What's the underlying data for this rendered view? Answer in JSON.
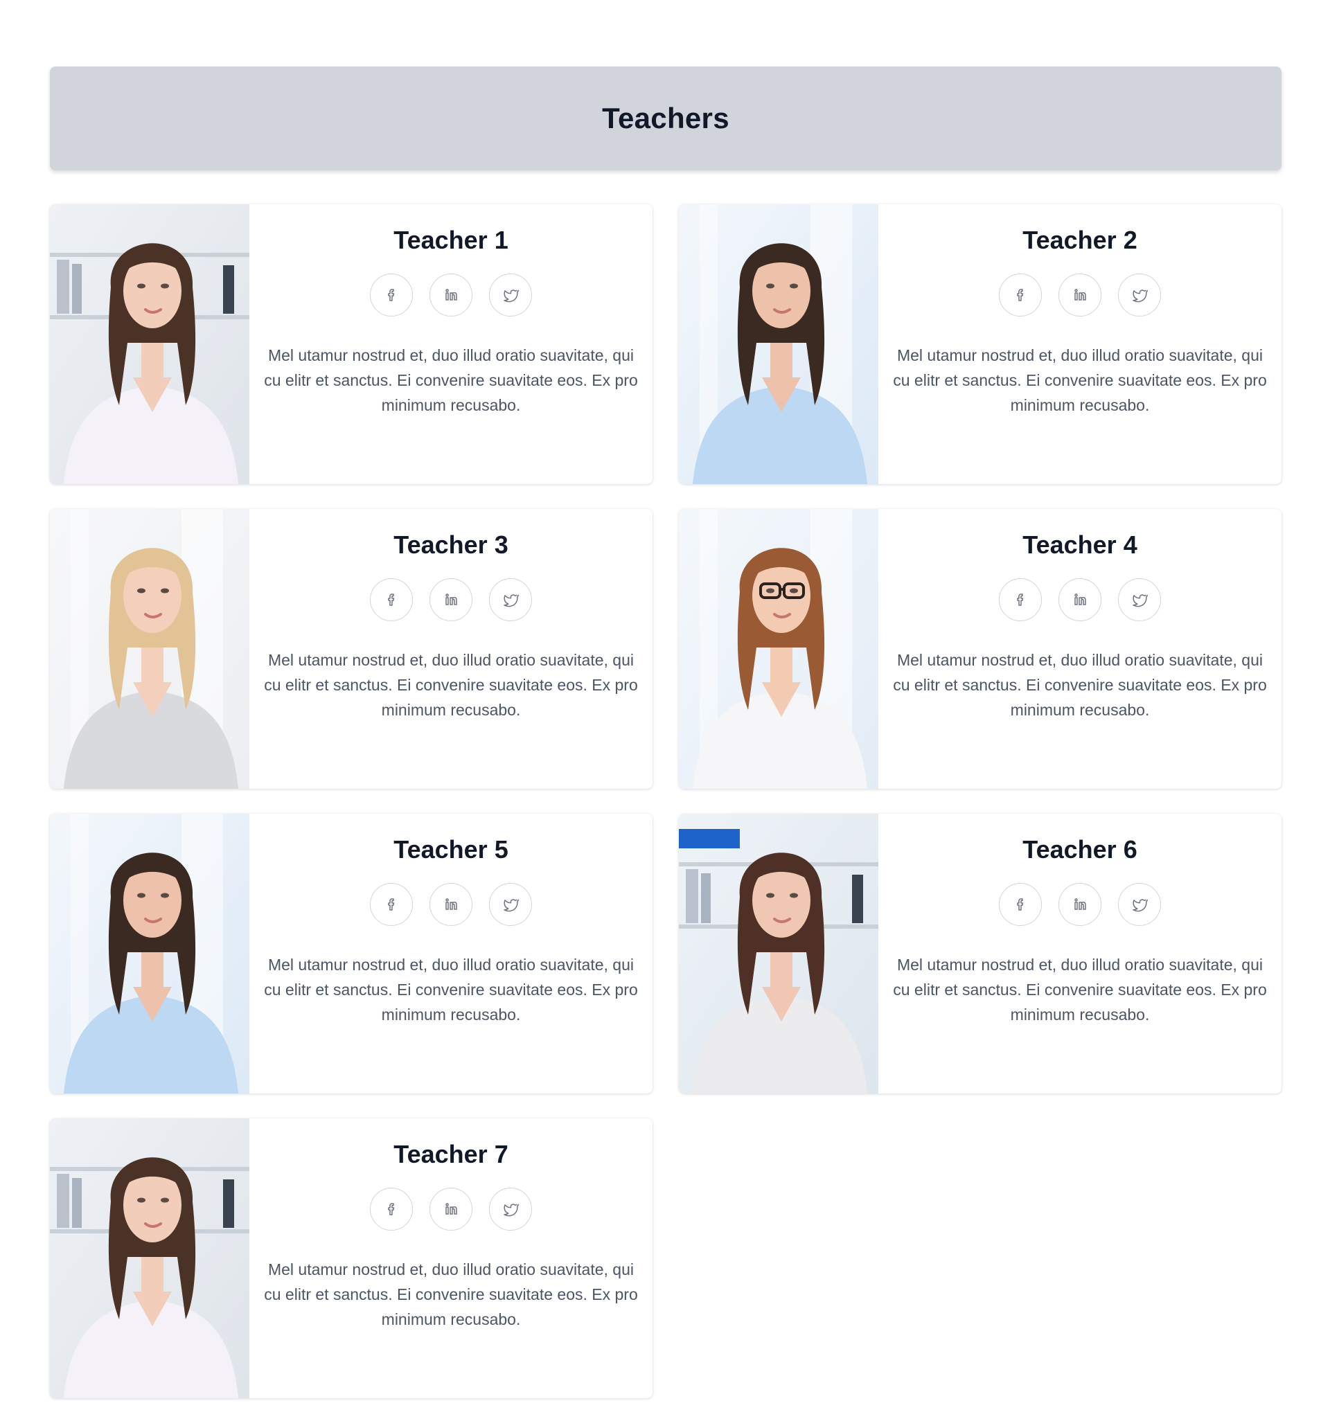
{
  "header": {
    "title": "Teachers"
  },
  "teachers": [
    {
      "name": "Teacher 1",
      "bio": "Mel utamur nostrud et, duo illud oratio suavitate, qui cu elitr et sanctus. Ei convenire suavitate eos. Ex pro minimum recusabo.",
      "photo": "portrait-brunette-white-blouse"
    },
    {
      "name": "Teacher 2",
      "bio": "Mel utamur nostrud et, duo illud oratio suavitate, qui cu elitr et sanctus. Ei convenire suavitate eos. Ex pro minimum recusabo.",
      "photo": "portrait-brunette-blue-shirt"
    },
    {
      "name": "Teacher 3",
      "bio": "Mel utamur nostrud et, duo illud oratio suavitate, qui cu elitr et sanctus. Ei convenire suavitate eos. Ex pro minimum recusabo.",
      "photo": "portrait-blonde-grey-blazer"
    },
    {
      "name": "Teacher 4",
      "bio": "Mel utamur nostrud et, duo illud oratio suavitate, qui cu elitr et sanctus. Ei convenire suavitate eos. Ex pro minimum recusabo.",
      "photo": "portrait-redhead-glasses"
    },
    {
      "name": "Teacher 5",
      "bio": "Mel utamur nostrud et, duo illud oratio suavitate, qui cu elitr et sanctus. Ei convenire suavitate eos. Ex pro minimum recusabo.",
      "photo": "portrait-brunette-blue-shirt"
    },
    {
      "name": "Teacher 6",
      "bio": "Mel utamur nostrud et, duo illud oratio suavitate, qui cu elitr et sanctus. Ei convenire suavitate eos. Ex pro minimum recusabo.",
      "photo": "portrait-brunette-white-sweater"
    },
    {
      "name": "Teacher 7",
      "bio": "Mel utamur nostrud et, duo illud oratio suavitate, qui cu elitr et sanctus. Ei convenire suavitate eos. Ex pro minimum recusabo.",
      "photo": "portrait-brunette-white-blouse"
    }
  ],
  "social_icons": [
    "facebook-icon",
    "linkedin-icon",
    "twitter-icon"
  ],
  "colors": {
    "header_bg": "#d1d5db",
    "title_text": "#111827",
    "body_text": "#4b5563",
    "icon_stroke": "#6b7280"
  }
}
